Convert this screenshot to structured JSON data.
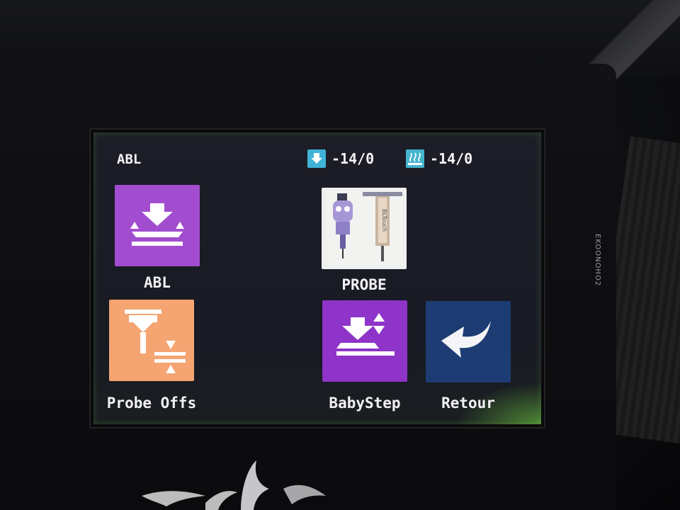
{
  "screen": {
    "title": "ABL",
    "status": {
      "nozzle_icon": "nozzle-down-arrow-icon",
      "nozzle_temp": "-14/0",
      "bed_icon": "heated-bed-icon",
      "bed_temp": "-14/0"
    },
    "buttons": [
      {
        "id": "abl",
        "label": "ABL",
        "icon": "bed-leveling-icon",
        "color": "#a24dd0"
      },
      {
        "id": "probe",
        "label": "PROBE",
        "icon": "bltouch-probe-icon",
        "color": "#eef0ee"
      },
      {
        "id": "probe-offset",
        "label": "Probe Offs",
        "icon": "probe-offset-icon",
        "color": "#f4a572"
      },
      {
        "id": "babystep",
        "label": "BabyStep",
        "icon": "babystep-icon",
        "color": "#8f34c8"
      },
      {
        "id": "back",
        "label": "Retour",
        "icon": "back-arrow-icon",
        "color": "#1d3c73"
      }
    ],
    "probe_image_text": "BLTouch"
  },
  "device": {
    "side_label": "EKOONOHO2"
  }
}
